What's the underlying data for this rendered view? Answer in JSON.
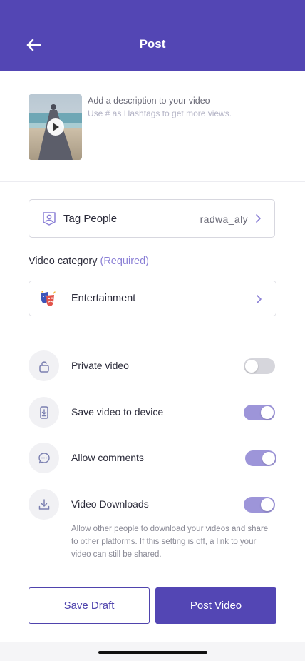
{
  "header": {
    "title": "Post"
  },
  "media": {
    "description_title": "Add a description to your video",
    "description_hint": "Use # as Hashtags to get more views."
  },
  "tag_people": {
    "label": "Tag People",
    "value": "radwa_aly"
  },
  "category": {
    "label": "Video category",
    "required": "(Required)",
    "value": "Entertainment"
  },
  "settings": [
    {
      "label": "Private video",
      "icon": "lock-icon",
      "enabled": false
    },
    {
      "label": "Save video to device",
      "icon": "save-device-icon",
      "enabled": true
    },
    {
      "label": "Allow comments",
      "icon": "comment-icon",
      "enabled": true
    },
    {
      "label": "Video Downloads",
      "icon": "download-icon",
      "enabled": true
    }
  ],
  "downloads_help": "Allow other people to download your videos and share to other platforms. If this setting is off, a link to your video can still be shared.",
  "buttons": {
    "save_draft": "Save Draft",
    "post_video": "Post Video"
  },
  "colors": {
    "primary": "#5346b4",
    "toggle_on": "#9d95d9",
    "toggle_off": "#d6d6dc",
    "required": "#8b80d6"
  }
}
